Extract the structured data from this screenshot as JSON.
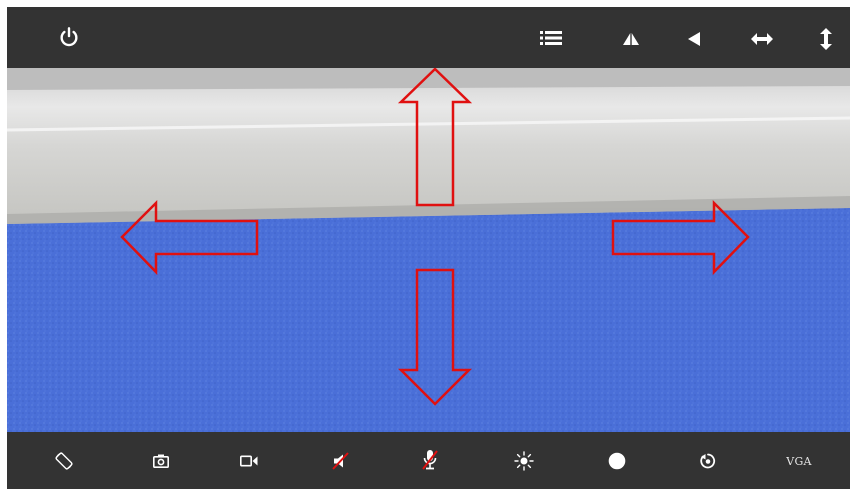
{
  "app": {
    "colors": {
      "bar": "#333333",
      "icon": "#ffffff",
      "arrow_outline": "#e01010",
      "arrow_fill": "#ffffff",
      "shelf": "#d9d9d9",
      "background_blue": "#4a6fd8",
      "mute_slash": "#e01010"
    }
  },
  "toolbar_top": {
    "items": [
      {
        "icon": "power-icon"
      },
      {
        "icon": "menu-icon"
      },
      {
        "icon": "flip-vertical-icon"
      },
      {
        "icon": "rotate-left-icon"
      },
      {
        "icon": "swap-horizontal-icon"
      },
      {
        "icon": "swap-vertical-icon"
      }
    ]
  },
  "toolbar_bottom": {
    "items": [
      {
        "icon": "rotate-screen-icon"
      },
      {
        "icon": "camera-icon"
      },
      {
        "icon": "video-icon"
      },
      {
        "icon": "speaker-muted-icon"
      },
      {
        "icon": "microphone-muted-icon"
      },
      {
        "icon": "brightness-icon"
      },
      {
        "icon": "contrast-icon"
      },
      {
        "icon": "reset-icon"
      },
      {
        "icon": "resolution-label",
        "label": "VGA"
      }
    ]
  },
  "overlay": {
    "arrows": [
      {
        "direction": "up"
      },
      {
        "direction": "left"
      },
      {
        "direction": "right"
      },
      {
        "direction": "down"
      }
    ]
  }
}
